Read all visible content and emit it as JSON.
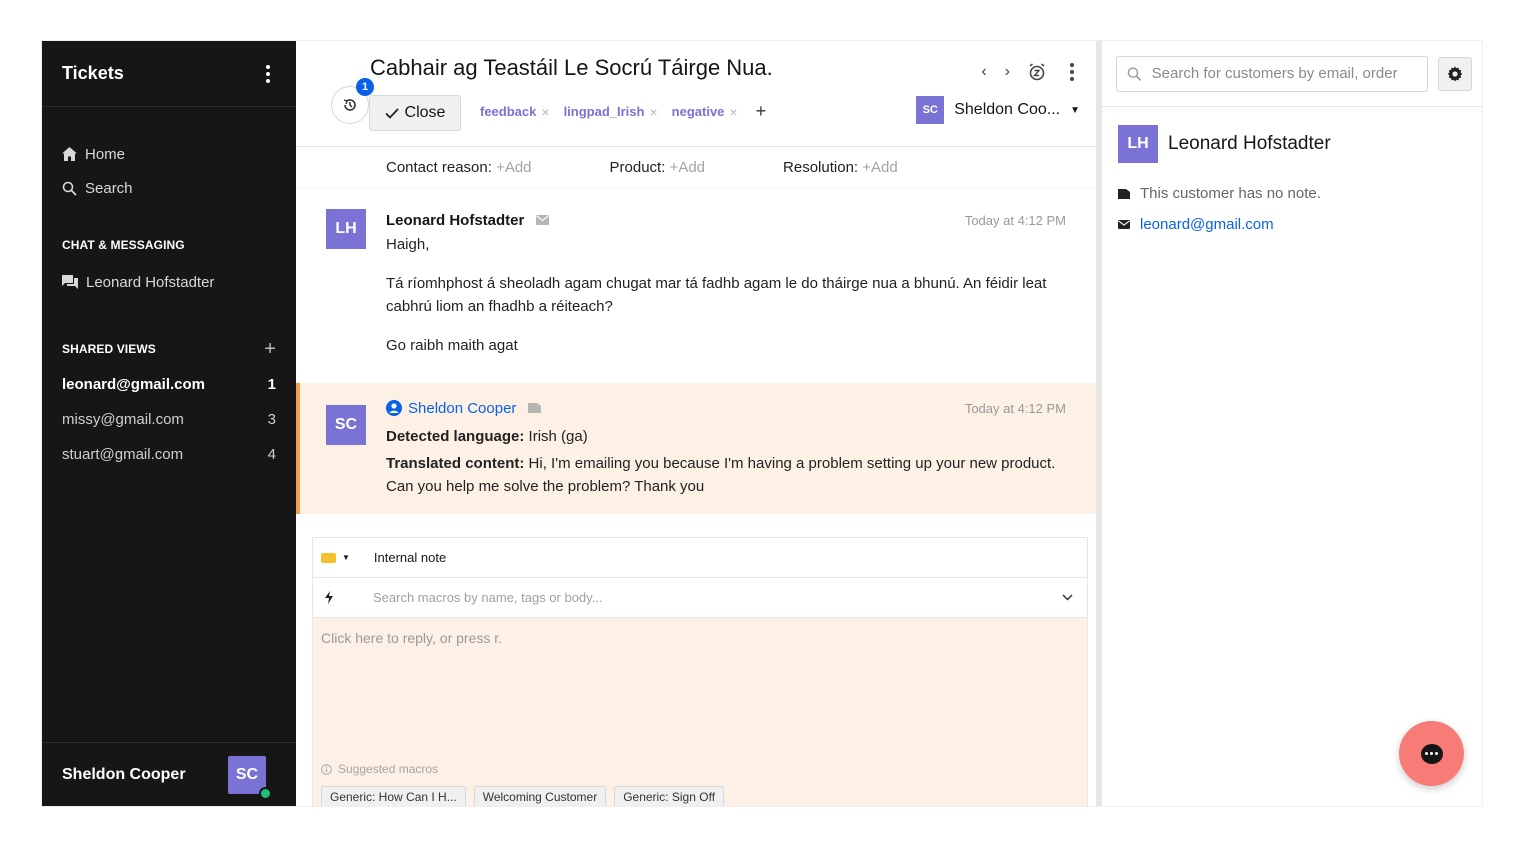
{
  "sidebar": {
    "title": "Tickets",
    "nav": [
      {
        "label": "Home",
        "icon": "home-icon"
      },
      {
        "label": "Search",
        "icon": "search-icon"
      }
    ],
    "chat_section_title": "CHAT & MESSAGING",
    "chat_item": "Leonard Hofstadter",
    "views_section_title": "SHARED VIEWS",
    "views": [
      {
        "label": "leonard@gmail.com",
        "count": "1"
      },
      {
        "label": "missy@gmail.com",
        "count": "3"
      },
      {
        "label": "stuart@gmail.com",
        "count": "4"
      }
    ],
    "footer_name": "Sheldon Cooper",
    "footer_avatar": "SC"
  },
  "ticket": {
    "title": "Cabhair ag Teastáil Le Socrú Táirge Nua.",
    "history_badge": "1",
    "close_label": "Close",
    "tags": [
      "feedback",
      "lingpad_Irish",
      "negative"
    ],
    "add_tag": "+",
    "assignee_initials": "SC",
    "assignee_name": "Sheldon Coo..."
  },
  "fields": {
    "contact_reason_label": "Contact reason:",
    "product_label": "Product:",
    "resolution_label": "Resolution:",
    "add_label": "+Add"
  },
  "messages": {
    "customer": {
      "initials": "LH",
      "author": "Leonard Hofstadter",
      "time": "Today at 4:12 PM",
      "greeting": "Haigh,",
      "body": "Tá ríomhphost á sheoladh agam chugat mar tá fadhb agam le do tháirge nua a bhunú. An féidir leat cabhrú liom an fhadhb a réiteach?",
      "signoff": "Go raibh maith agat"
    },
    "translation": {
      "initials": "SC",
      "author": "Sheldon Cooper",
      "time": "Today at 4:12 PM",
      "lang_label": "Detected language:",
      "lang_value": "Irish (ga)",
      "content_label": "Translated content:",
      "content_value": "Hi, I'm emailing you because I'm having a problem setting up your new product. Can you help me solve the problem? Thank you"
    }
  },
  "reply": {
    "type_label": "Internal note",
    "macro_placeholder": "Search macros by name, tags or body...",
    "reply_placeholder": "Click here to reply, or press r.",
    "suggested_label": "Suggested macros",
    "macros": [
      "Generic: How Can I H...",
      "Welcoming Customer",
      "Generic: Sign Off"
    ]
  },
  "customer_panel": {
    "search_placeholder": "Search for customers by email, order",
    "initials": "LH",
    "name": "Leonard Hofstadter",
    "note": "This customer has no note.",
    "email": "leonard@gmail.com"
  },
  "colors": {
    "sidebar_bg": "#161616",
    "avatar_purple": "#7a72d4",
    "link_blue": "#0a61e6",
    "translation_bg": "#fdf1e6",
    "translation_accent": "#f59e4a",
    "fab": "#f77b76",
    "online": "#1fbf75"
  }
}
